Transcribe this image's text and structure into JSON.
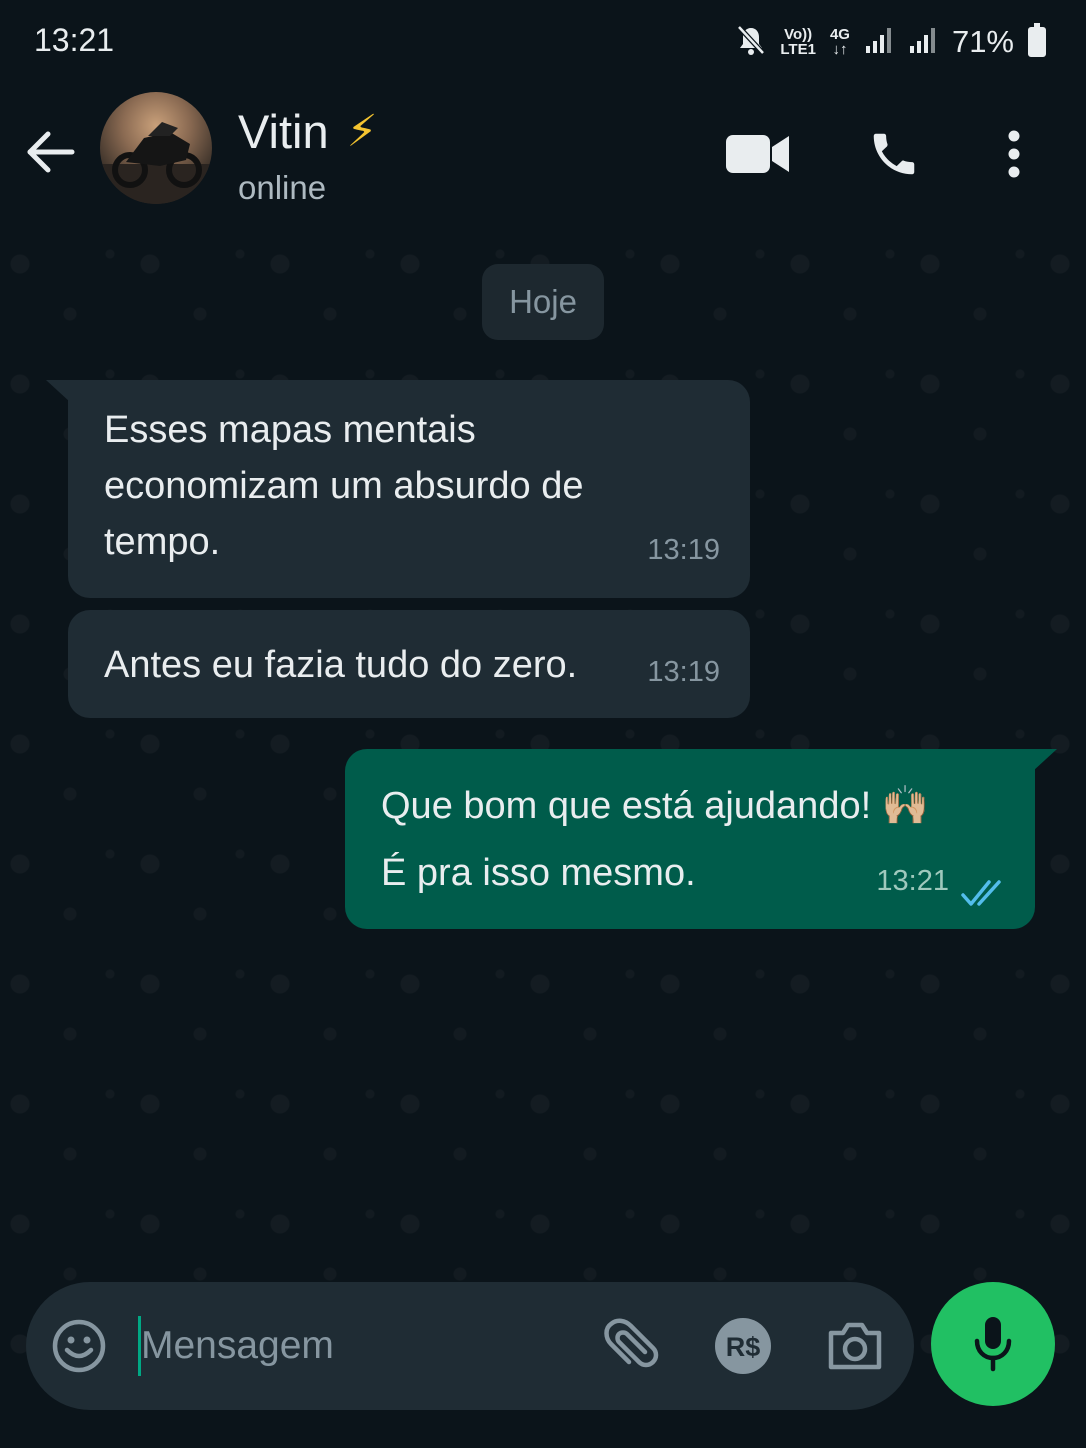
{
  "status_bar": {
    "time": "13:21",
    "network_top": "Vo))",
    "network_bottom": "LTE1",
    "net_type_top": "4G",
    "net_type_bottom": "↓↑",
    "battery": "71%"
  },
  "header": {
    "contact_name": "Vitin",
    "name_emoji": "⚡",
    "status": "online"
  },
  "chat": {
    "day_label": "Hoje",
    "messages": [
      {
        "direction": "in",
        "text": "Esses mapas mentais economizam um absurdo de tempo.",
        "time": "13:19"
      },
      {
        "direction": "in",
        "text": "Antes eu fazia tudo do zero.",
        "time": "13:19"
      },
      {
        "direction": "out",
        "line1": "Que bom que está ajudando! 🙌🏼",
        "line2": "É pra isso mesmo.",
        "time": "13:21",
        "status": "read"
      }
    ]
  },
  "composer": {
    "placeholder": "Mensagem",
    "value": ""
  },
  "colors": {
    "background": "#0b141a",
    "incoming_bubble": "#1f2c34",
    "outgoing_bubble": "#005c4b",
    "accent": "#21c063",
    "read_ticks": "#53bdeb"
  }
}
